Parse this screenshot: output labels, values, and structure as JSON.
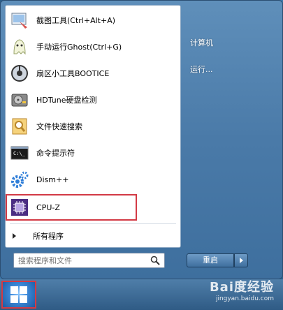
{
  "programs": [
    {
      "label": "截图工具(Ctrl+Alt+A)",
      "icon": "snipping-tool-icon"
    },
    {
      "label": "手动运行Ghost(Ctrl+G)",
      "icon": "ghost-icon"
    },
    {
      "label": "扇区小工具BOOTICE",
      "icon": "bootice-icon"
    },
    {
      "label": "HDTune硬盘检测",
      "icon": "hard-disk-icon"
    },
    {
      "label": "文件快速搜索",
      "icon": "file-search-icon"
    },
    {
      "label": "命令提示符",
      "icon": "command-prompt-icon"
    },
    {
      "label": "Dism++",
      "icon": "gear-icon"
    },
    {
      "label": "CPU-Z",
      "icon": "cpu-icon"
    }
  ],
  "all_programs_label": "所有程序",
  "search": {
    "placeholder": "搜索程序和文件"
  },
  "right_pane": {
    "computer_label": "计算机",
    "run_label": "运行..."
  },
  "shutdown_label": "重启",
  "watermark": {
    "main": "Bai度经验",
    "sub": "jingyan.baidu.com"
  },
  "colors": {
    "highlight_border": "#d33a45",
    "accent": "#3e6f9e"
  }
}
